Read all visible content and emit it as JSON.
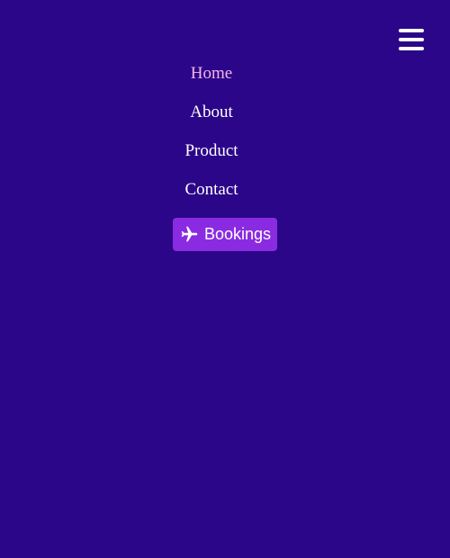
{
  "nav": {
    "items": [
      {
        "label": "Home",
        "active": true
      },
      {
        "label": "About",
        "active": false
      },
      {
        "label": "Product",
        "active": false
      },
      {
        "label": "Contact",
        "active": false
      }
    ]
  },
  "cta": {
    "label": "Bookings",
    "icon": "plane-icon"
  },
  "menu_toggle": {
    "icon": "hamburger-icon"
  },
  "colors": {
    "background": "#2b0689",
    "nav_text": "#ffffff",
    "nav_active": "#f6b6e8",
    "cta_background": "#8a2be2"
  }
}
